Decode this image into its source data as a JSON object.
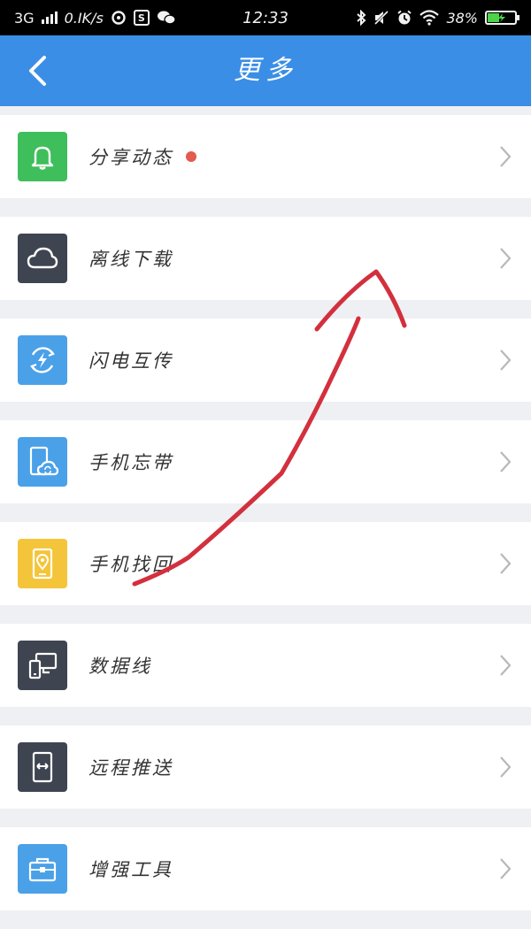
{
  "status_bar": {
    "network": "3G",
    "speed": "0.IK/s",
    "time": "12:33",
    "battery": "38%"
  },
  "header": {
    "title": "更多"
  },
  "colors": {
    "header_bg": "#3a8ee6",
    "red_dot": "#e35a4e",
    "annotation_red": "#d3303d"
  },
  "items": [
    {
      "label": "分享动态",
      "icon": "bell-icon",
      "color": "#3fbe5c",
      "badge": true
    },
    {
      "label": "离线下载",
      "icon": "cloud-icon",
      "color": "#3f4451"
    },
    {
      "label": "闪电互传",
      "icon": "lightning-sync-icon",
      "color": "#4aa1e8"
    },
    {
      "label": "手机忘带",
      "icon": "phone-cloud-icon",
      "color": "#4aa1e8"
    },
    {
      "label": "手机找回",
      "icon": "phone-location-icon",
      "color": "#f4c53a"
    },
    {
      "label": "数据线",
      "icon": "devices-icon",
      "color": "#3f4451"
    },
    {
      "label": "远程推送",
      "icon": "remote-push-icon",
      "color": "#3f4451"
    },
    {
      "label": "增强工具",
      "icon": "toolbox-icon",
      "color": "#4aa1e8"
    }
  ]
}
